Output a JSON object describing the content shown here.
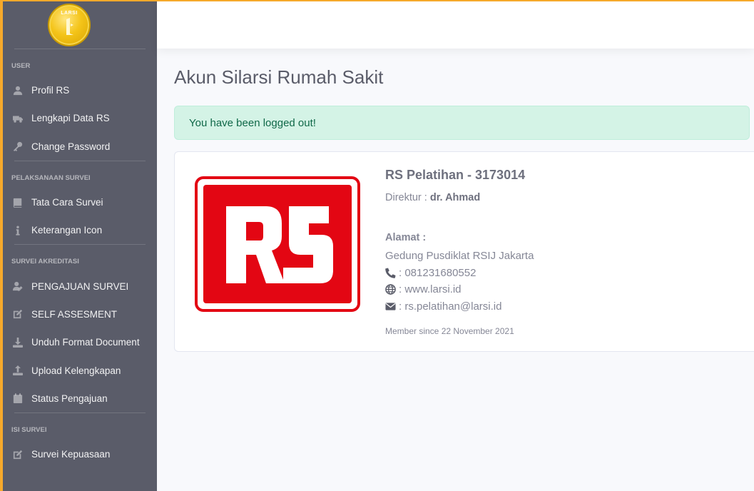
{
  "brand": {
    "logo_text": "LARSI"
  },
  "sidebar": {
    "sections": [
      {
        "heading": "USER",
        "items": [
          {
            "label": "Profil RS",
            "icon": "user-icon"
          },
          {
            "label": "Lengkapi Data RS",
            "icon": "truck-icon"
          },
          {
            "label": "Change Password",
            "icon": "key-icon"
          }
        ]
      },
      {
        "heading": "PELAKSANAAN SURVEI",
        "items": [
          {
            "label": "Tata Cara Survei",
            "icon": "book-icon"
          },
          {
            "label": "Keterangan Icon",
            "icon": "info-icon"
          }
        ]
      },
      {
        "heading": "SURVEI AKREDITASI",
        "items": [
          {
            "label": "PENGAJUAN SURVEI",
            "icon": "user-edit-icon"
          },
          {
            "label": "SELF ASSESMENT",
            "icon": "edit-icon"
          },
          {
            "label": "Unduh Format Document",
            "icon": "download-icon"
          },
          {
            "label": "Upload Kelengkapan",
            "icon": "upload-icon"
          },
          {
            "label": "Status Pengajuan",
            "icon": "calendar-icon"
          }
        ]
      },
      {
        "heading": "ISI SURVEI",
        "items": [
          {
            "label": "Survei Kepuasaan",
            "icon": "edit-icon"
          }
        ]
      }
    ]
  },
  "main": {
    "title": "Akun Silarsi Rumah Sakit",
    "alert": "You have been logged out!",
    "profile": {
      "logo_text": "RS",
      "name": "RS Pelatihan - 3173014",
      "direktur_label": "Direktur :",
      "direktur_value": "dr. Ahmad",
      "alamat_label": "Alamat :",
      "alamat_value": "Gedung Pusdiklat RSIJ Jakarta",
      "phone": ": 081231680552",
      "website": ": www.larsi.id",
      "email": ": rs.pelatihan@larsi.id",
      "member_since": "Member since 22 November 2021"
    }
  },
  "colors": {
    "sidebar_bg": "#5a5c69",
    "accent": "#f6a92b",
    "alert_bg": "#d4f3e6",
    "alert_text": "#0f6848",
    "rs_red": "#e30613"
  }
}
